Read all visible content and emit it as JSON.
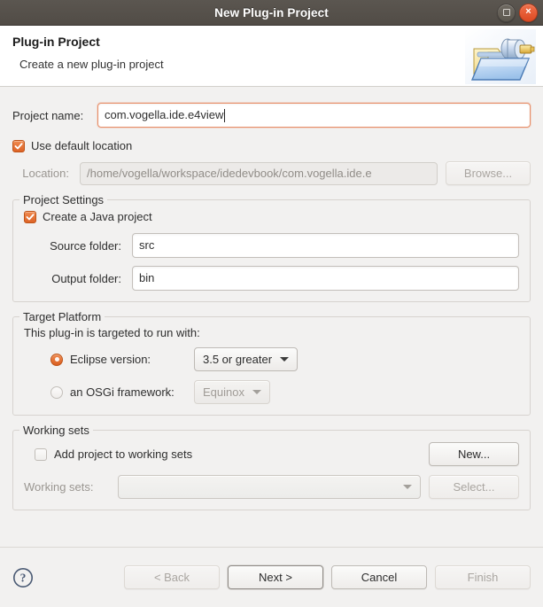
{
  "window": {
    "title": "New Plug-in Project",
    "maximize_label": "maximize-icon",
    "close_label": "×"
  },
  "header": {
    "title": "Plug-in Project",
    "subtitle": "Create a new plug-in project",
    "icon": "plugin-project-wizard-icon"
  },
  "project_name": {
    "label": "Project name:",
    "value": "com.vogella.ide.e4view"
  },
  "use_default_location": {
    "label": "Use default location",
    "checked": true
  },
  "location": {
    "label": "Location:",
    "value": "/home/vogella/workspace/idedevbook/com.vogella.ide.e",
    "browse_label": "Browse..."
  },
  "project_settings": {
    "title": "Project Settings",
    "create_java_project": {
      "label": "Create a Java project",
      "checked": true
    },
    "source_folder": {
      "label": "Source folder:",
      "value": "src"
    },
    "output_folder": {
      "label": "Output folder:",
      "value": "bin"
    }
  },
  "target_platform": {
    "title": "Target Platform",
    "description": "This plug-in is targeted to run with:",
    "eclipse_version": {
      "label": "Eclipse version:",
      "selected": true,
      "value": "3.5 or greater"
    },
    "osgi_framework": {
      "label": "an OSGi framework:",
      "selected": false,
      "value": "Equinox"
    }
  },
  "working_sets": {
    "title": "Working sets",
    "add_project": {
      "label": "Add project to working sets",
      "checked": false
    },
    "new_label": "New...",
    "working_sets_label": "Working sets:",
    "working_sets_value": "",
    "select_label": "Select..."
  },
  "footer": {
    "help_label": "help-icon",
    "back_label": "< Back",
    "next_label": "Next >",
    "cancel_label": "Cancel",
    "finish_label": "Finish"
  },
  "colors": {
    "titlebar": "#544f49",
    "accent_orange": "#dd6326",
    "background": "#f2f1f0",
    "close_button": "#e2552a",
    "focus_border": "#e8906a"
  }
}
